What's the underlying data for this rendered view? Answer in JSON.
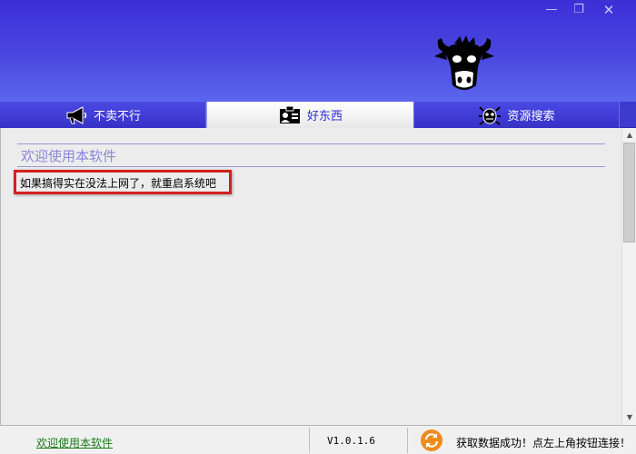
{
  "window": {
    "minimize_glyph": "—",
    "maximize_glyph": "❐",
    "close_glyph": "✕"
  },
  "logo": {
    "icon": "cow-head-icon"
  },
  "tabs": [
    {
      "label": "不卖不行",
      "icon": "megaphone-icon",
      "active": false
    },
    {
      "label": "好东西",
      "icon": "id-card-icon",
      "active": true
    },
    {
      "label": "资源搜索",
      "icon": "bug-icon",
      "active": false
    }
  ],
  "content": {
    "title": "欢迎使用本软件",
    "tip": "如果搞得实在没法上网了，就重启系统吧"
  },
  "scrollbar": {
    "up_glyph": "▲",
    "down_glyph": "▼"
  },
  "statusbar": {
    "welcome_link": "欢迎使用本软件",
    "version": "V1.0.1.6",
    "message": "获取数据成功！点左上角按钮连接！"
  },
  "colors": {
    "header_top": "#3b2fd6",
    "header_bottom": "#5b66ee",
    "highlight_border": "#d42020",
    "link_green": "#1a7a1a",
    "refresh_orange": "#f08a1c"
  }
}
